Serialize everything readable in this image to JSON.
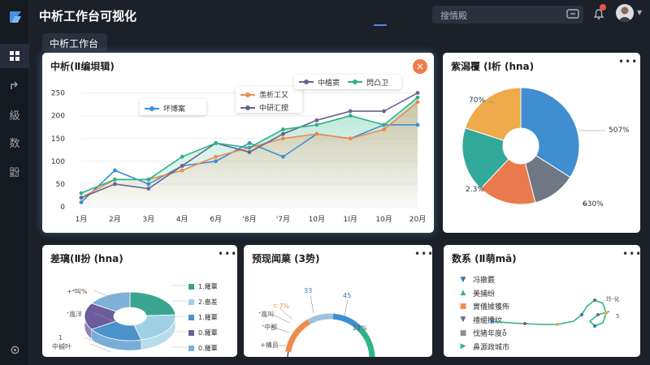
{
  "app": {
    "title": "中析工作台可视化"
  },
  "search": {
    "value": "搜情殿"
  },
  "notifications": {
    "count": "3"
  },
  "page_tab": {
    "label": "中析工作台"
  },
  "sidebar": {
    "items": [
      {
        "label": "",
        "icon": "grid-icon"
      },
      {
        "label": "",
        "icon": "share-icon"
      },
      {
        "label": "級",
        "icon": ""
      },
      {
        "label": "数",
        "icon": ""
      },
      {
        "label": "鼢",
        "icon": ""
      }
    ],
    "settings_icon": "gear-icon"
  },
  "main_chart": {
    "title": "中析(Ⅱ编垻辑)",
    "legend_a": [
      "坏博案"
    ],
    "legend_b": [
      "羡析工又",
      "中研汇搅"
    ],
    "legend_c": [
      "中植窦",
      "閃凸卫"
    ],
    "colors": [
      "#3b8fd0",
      "#ef8a4c",
      "#6b6390",
      "#2eb38a"
    ]
  },
  "chart_data": [
    {
      "type": "line",
      "title": "中析(Ⅱ编垻辑)",
      "categories": [
        "1月",
        "2月",
        "3月",
        "4月",
        "6月",
        "'8月",
        "'7月",
        "10月",
        "1Ⅰ月",
        "10月",
        "20月"
      ],
      "yticks": [
        0,
        50,
        100,
        150,
        200,
        250
      ],
      "ylim": [
        0,
        260
      ],
      "series": [
        {
          "name": "坏博案",
          "color": "#3b8fd0",
          "values": [
            10,
            80,
            50,
            90,
            100,
            140,
            110,
            160,
            150,
            180,
            180
          ]
        },
        {
          "name": "羡析工又",
          "color": "#ef8a4c",
          "values": [
            20,
            60,
            60,
            80,
            110,
            130,
            150,
            160,
            150,
            170,
            230
          ]
        },
        {
          "name": "中研汇搅",
          "color": "#6b6390",
          "values": [
            20,
            50,
            40,
            90,
            140,
            120,
            160,
            190,
            210,
            210,
            250
          ]
        },
        {
          "name": "閃凸卫",
          "color": "#2eb38a",
          "values": [
            30,
            60,
            60,
            110,
            140,
            130,
            170,
            180,
            200,
            180,
            240
          ]
        }
      ]
    },
    {
      "type": "pie",
      "title": "紫潟覆 (l析 (hna)",
      "slices": [
        {
          "label": "507%",
          "value": 34,
          "color": "#3f8fd0"
        },
        {
          "label": "",
          "value": 12,
          "color": "#6f7785"
        },
        {
          "label": "6̶30%",
          "value": 16,
          "color": "#e97a4d"
        },
        {
          "label": "2.3%",
          "value": 18,
          "color": "#32a89a"
        },
        {
          "label": "70%",
          "value": 20,
          "color": "#efaa4c"
        }
      ]
    },
    {
      "type": "pie",
      "title": "差璃(Ⅱ扮 (hna)",
      "slices": [
        {
          "label": "1.羅蕈",
          "value": 24,
          "color": "#3aa58f"
        },
        {
          "label": "2.嗇差",
          "value": 22,
          "color": "#9fd0e6"
        },
        {
          "label": "1.羅蕈",
          "value": 20,
          "color": "#4a93c8"
        },
        {
          "label": "0.羅蕈",
          "value": 18,
          "color": "#6c5c9b"
        },
        {
          "label": "0.羅蕈",
          "value": 16,
          "color": "#7fb0d8"
        }
      ]
    },
    {
      "type": "pie",
      "title": "预现闻菓 (3势)",
      "slices": [
        {
          "label": "ㄷ7%",
          "value": 18,
          "color": "#ef8a4c"
        },
        {
          "label": "33",
          "value": 12,
          "color": "#9fc3de"
        },
        {
          "label": "45",
          "value": 14,
          "color": "#3b8fd0"
        },
        {
          "label": "12%",
          "value": 16,
          "color": "#2eb38a"
        }
      ]
    }
  ],
  "pie_card": {
    "title": "紫潟覆 (l析 (hna)",
    "labels": {
      "tl": "70%",
      "r": "507%",
      "bl": "2.3%",
      "br": "6̶30%"
    }
  },
  "donut3d_card": {
    "title": "差璃(Ⅱ扮 (hna)",
    "left_labels": [
      "+⁴叫%",
      "ᐩ嵐泮",
      "1",
      "中槭叶"
    ],
    "right_labels": [
      "1.羅蕈",
      "2.嗇差",
      "1.羅蕈",
      "0.羅蕈",
      "0.羅蕈"
    ],
    "right_colors": [
      "#3aa58f",
      "#9fd0e6",
      "#4a93c8",
      "#6c5c9b",
      "#7fb0d8"
    ]
  },
  "gauge_card": {
    "title": "预现闻菓 (3势)",
    "labels": [
      "ㄷ7%",
      "33",
      "45",
      "ᐩ嵐叫",
      "12%",
      "ᐩ中鄯",
      "+構员"
    ]
  },
  "legend_card": {
    "title": "数系 (Ⅱ萌mā)",
    "items": [
      {
        "symbol": "▼",
        "color": "#3b6fb6",
        "label": "冯撤覈"
      },
      {
        "symbol": "▲",
        "color": "#2eb38a",
        "label": "美捕纷"
      },
      {
        "symbol": "■",
        "color": "#ef8a4c",
        "label": "實儀據獲佈"
      },
      {
        "symbol": "▼",
        "color": "#6b6390",
        "label": "禮缓攮纹"
      },
      {
        "symbol": "■",
        "color": "#8a8f98",
        "label": "伐猪年度ỗ"
      },
      {
        "symbol": "▶",
        "color": "#2eb38a",
        "label": "鼻源政城市"
      }
    ],
    "mini_labels": [
      "玲-化",
      "5"
    ]
  }
}
